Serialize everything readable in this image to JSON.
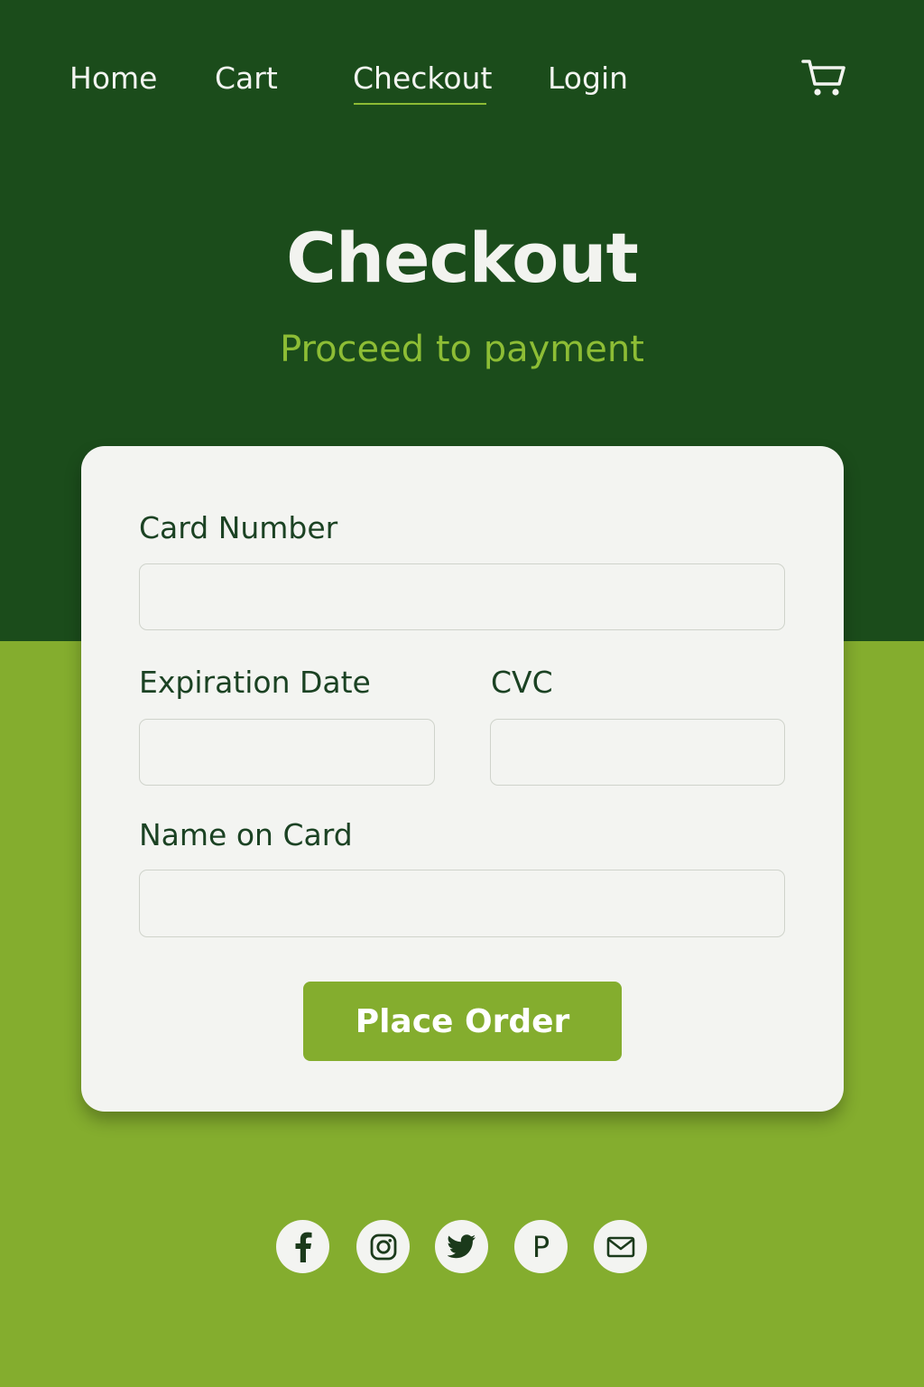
{
  "nav": {
    "items": [
      {
        "label": "Home"
      },
      {
        "label": "Cart"
      },
      {
        "label": "Checkout",
        "active": true
      },
      {
        "label": "Login"
      }
    ],
    "cart_icon": "shopping-cart-icon"
  },
  "hero": {
    "title": "Checkout",
    "subtitle": "Proceed to payment"
  },
  "form": {
    "card_number": {
      "label": "Card Number",
      "value": "",
      "placeholder": ""
    },
    "expiration": {
      "label": "Expiration Date",
      "value": "",
      "placeholder": ""
    },
    "cvc": {
      "label": "CVC",
      "value": "",
      "placeholder": ""
    },
    "name": {
      "label": "Name on Card",
      "value": "",
      "placeholder": ""
    },
    "submit_label": "Place Order"
  },
  "social": [
    {
      "icon": "facebook-icon"
    },
    {
      "icon": "instagram-icon"
    },
    {
      "icon": "twitter-icon"
    },
    {
      "icon": "pinterest-icon",
      "glyph": "P"
    },
    {
      "icon": "email-icon"
    }
  ],
  "colors": {
    "header_bg": "#1b4c1b",
    "footer_bg": "#84ad2e",
    "accent": "#8dbd35",
    "card_bg": "#f3f4f1",
    "label_text": "#1b4223",
    "button_bg": "#84ad2e"
  }
}
